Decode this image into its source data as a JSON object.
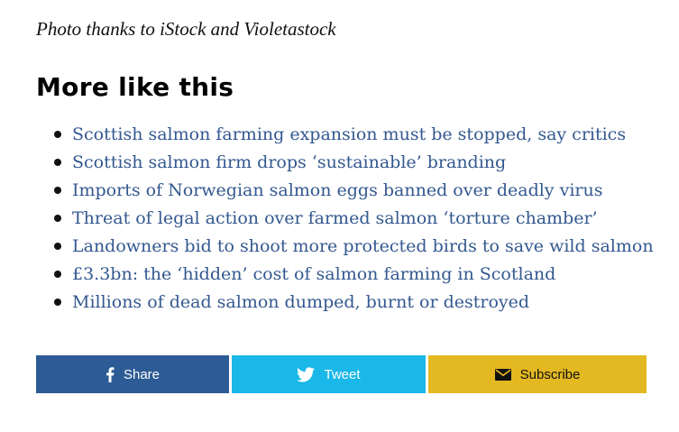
{
  "caption": "Photo thanks to iStock and Violetastock",
  "related": {
    "heading": "More like this",
    "items": [
      {
        "label": "Scottish salmon farming expansion must be stopped, say critics"
      },
      {
        "label": "Scottish salmon firm drops ‘sustainable’ branding"
      },
      {
        "label": "Imports of Norwegian salmon eggs banned over deadly virus"
      },
      {
        "label": "Threat of legal action over farmed salmon ‘torture chamber’"
      },
      {
        "label": "Landowners bid to shoot more protected birds to save wild salmon"
      },
      {
        "label": "£3.3bn: the ‘hidden’ cost of salmon farming in Scotland"
      },
      {
        "label": "Millions of dead salmon dumped, burnt or destroyed"
      }
    ]
  },
  "share_bar": {
    "facebook": {
      "label": "Share",
      "icon": "facebook-icon",
      "color": "#2d5b95"
    },
    "twitter": {
      "label": "Tweet",
      "icon": "twitter-bird-icon",
      "color": "#1ab8e8"
    },
    "subscribe": {
      "label": "Subscribe",
      "icon": "envelope-icon",
      "color": "#e3b820"
    }
  },
  "colors": {
    "link": "#33588f",
    "heading": "#000000"
  }
}
